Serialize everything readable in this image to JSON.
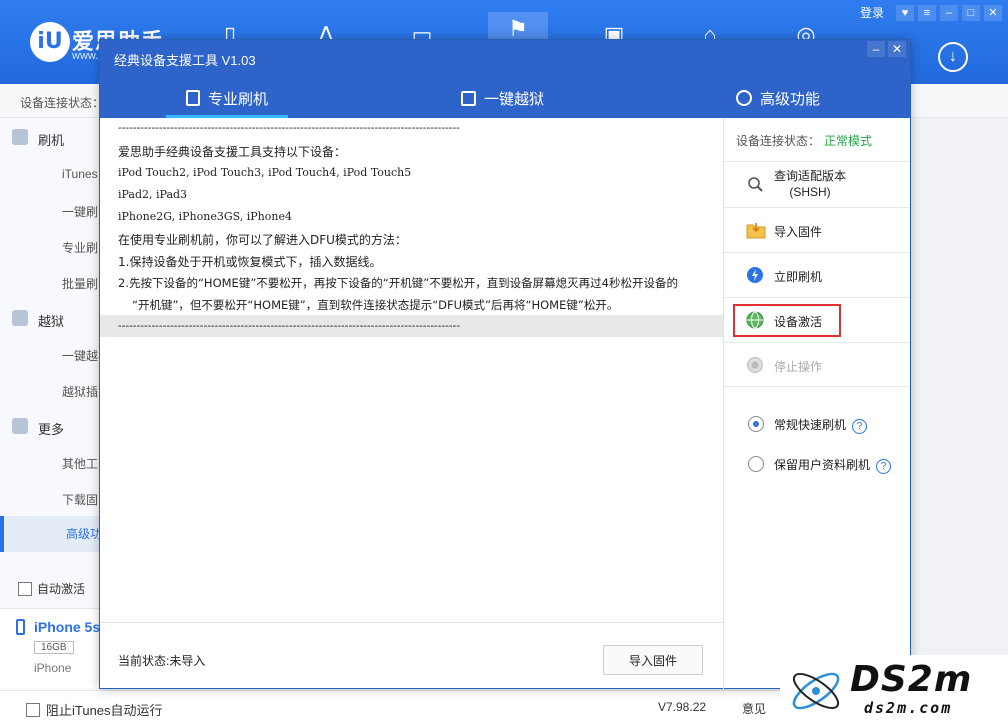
{
  "app": {
    "name": "爱思助手",
    "url": "www.",
    "login": "登录",
    "status_label": "设备连接状态：",
    "nav_icons": [
      "device-icon",
      "apps-icon",
      "media-icon",
      "flash-tools-icon",
      "toolbox-icon",
      "tutorials-icon",
      "compass-icon"
    ]
  },
  "sidebar": {
    "groups": [
      {
        "label": "刷机",
        "icon": "flash-icon"
      },
      {
        "label": "越狱",
        "icon": "shield-icon"
      },
      {
        "label": "更多",
        "icon": "menu-icon"
      }
    ],
    "items": [
      "iTunes",
      "一键刷",
      "专业刷",
      "批量刷",
      "一键越",
      "越狱插",
      "其他工",
      "下载固",
      "高级功"
    ],
    "auto_activate": "自动激活",
    "device_name": "iPhone 5s",
    "device_capacity": "16GB",
    "device_model": "iPhone"
  },
  "bottom": {
    "block_itunes": "阻止iTunes自动运行",
    "version": "V7.98.22",
    "feedback": "意见"
  },
  "dialog": {
    "title": "经典设备支援工具 V1.03",
    "tabs": [
      "专业刷机",
      "一键越狱",
      "高级功能"
    ],
    "log": {
      "separator": "--------------------------------------------------------------------------------------------",
      "line1": "爱思助手经典设备支援工具支持以下设备：",
      "line2": "iPod Touch2, iPod Touch3, iPod Touch4, iPod Touch5",
      "line3": "iPad2, iPad3",
      "line4": "iPhone2G, iPhone3GS, iPhone4",
      "line5": "在使用专业刷机前，你可以了解进入DFU模式的方法：",
      "line6": "1.保持设备处于开机或恢复模式下，插入数据线。",
      "line7": "2.先按下设备的“HOME键”不要松开，再按下设备的“开机键”不要松开，直到设备屏幕熄灭再过4秒松开设备的",
      "line8": "“开机键”，但不要松开“HOME键”，直到软件连接状态提示“DFU模式”后再将“HOME键”松开。"
    },
    "current_status": "当前状态:未导入",
    "import_button": "导入固件",
    "conn_label": "设备连接状态：",
    "conn_value": "正常模式",
    "actions": {
      "query_line1": "查询适配版本",
      "query_line2": "(SHSH)",
      "import": "导入固件",
      "flash_now": "立即刷机",
      "activate": "设备激活",
      "stop": "停止操作"
    },
    "options": {
      "quick": "常规快速刷机",
      "keep_data": "保留用户资料刷机"
    }
  },
  "watermark": {
    "main": "DS2m",
    "sub": "ds2m.com"
  },
  "colors": {
    "brand_blue": "#2e63c9",
    "status_green": "#23a547",
    "highlight_red": "#e03030"
  }
}
